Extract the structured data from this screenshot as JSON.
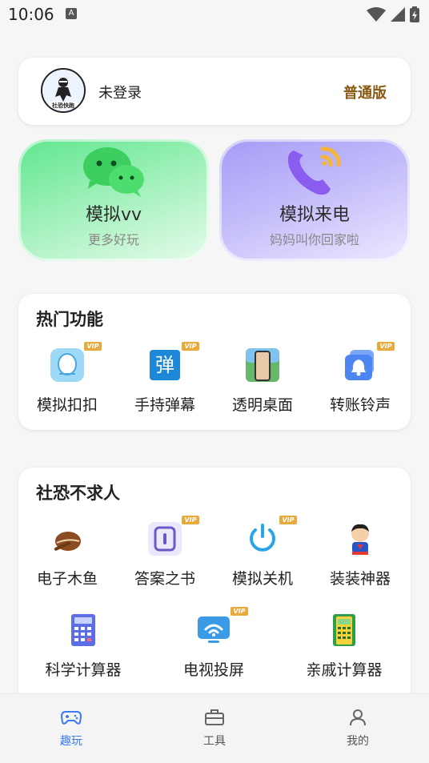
{
  "status": {
    "time": "10:06",
    "notif_letter": "A"
  },
  "login": {
    "status_text": "未登录",
    "edition": "普通版"
  },
  "features": [
    {
      "title": "模拟vv",
      "subtitle": "更多好玩",
      "icon": "wechat-icon"
    },
    {
      "title": "模拟来电",
      "subtitle": "妈妈叫你回家啦",
      "icon": "phone-call-icon"
    }
  ],
  "hot": {
    "title": "热门功能",
    "items": [
      {
        "label": "模拟扣扣",
        "icon": "qq-icon",
        "vip": "VIP"
      },
      {
        "label": "手持弹幕",
        "icon": "danmaku-icon",
        "vip": "VIP",
        "glyph": "弹"
      },
      {
        "label": "透明桌面",
        "icon": "transparent-desktop-icon"
      },
      {
        "label": "转账铃声",
        "icon": "bell-icon",
        "vip": "VIP"
      }
    ]
  },
  "social": {
    "title": "社恐不求人",
    "items": [
      {
        "label": "电子木鱼",
        "icon": "wooden-fish-icon"
      },
      {
        "label": "答案之书",
        "icon": "answer-book-icon",
        "vip": "VIP"
      },
      {
        "label": "模拟关机",
        "icon": "power-icon",
        "vip": "VIP"
      },
      {
        "label": "装装神器",
        "icon": "superhero-icon"
      },
      {
        "label": "科学计算器",
        "icon": "calculator-icon"
      },
      {
        "label": "电视投屏",
        "icon": "tv-cast-icon",
        "vip": "VIP"
      },
      {
        "label": "亲戚计算器",
        "icon": "relative-calculator-icon"
      }
    ]
  },
  "tabs": [
    {
      "label": "趣玩",
      "icon": "gamepad-icon",
      "active": true
    },
    {
      "label": "工具",
      "icon": "toolbox-icon"
    },
    {
      "label": "我的",
      "icon": "user-icon"
    }
  ],
  "colors": {
    "accent": "#3b7cf5",
    "vip": "#e9a93b",
    "edition": "#8a5a12"
  }
}
